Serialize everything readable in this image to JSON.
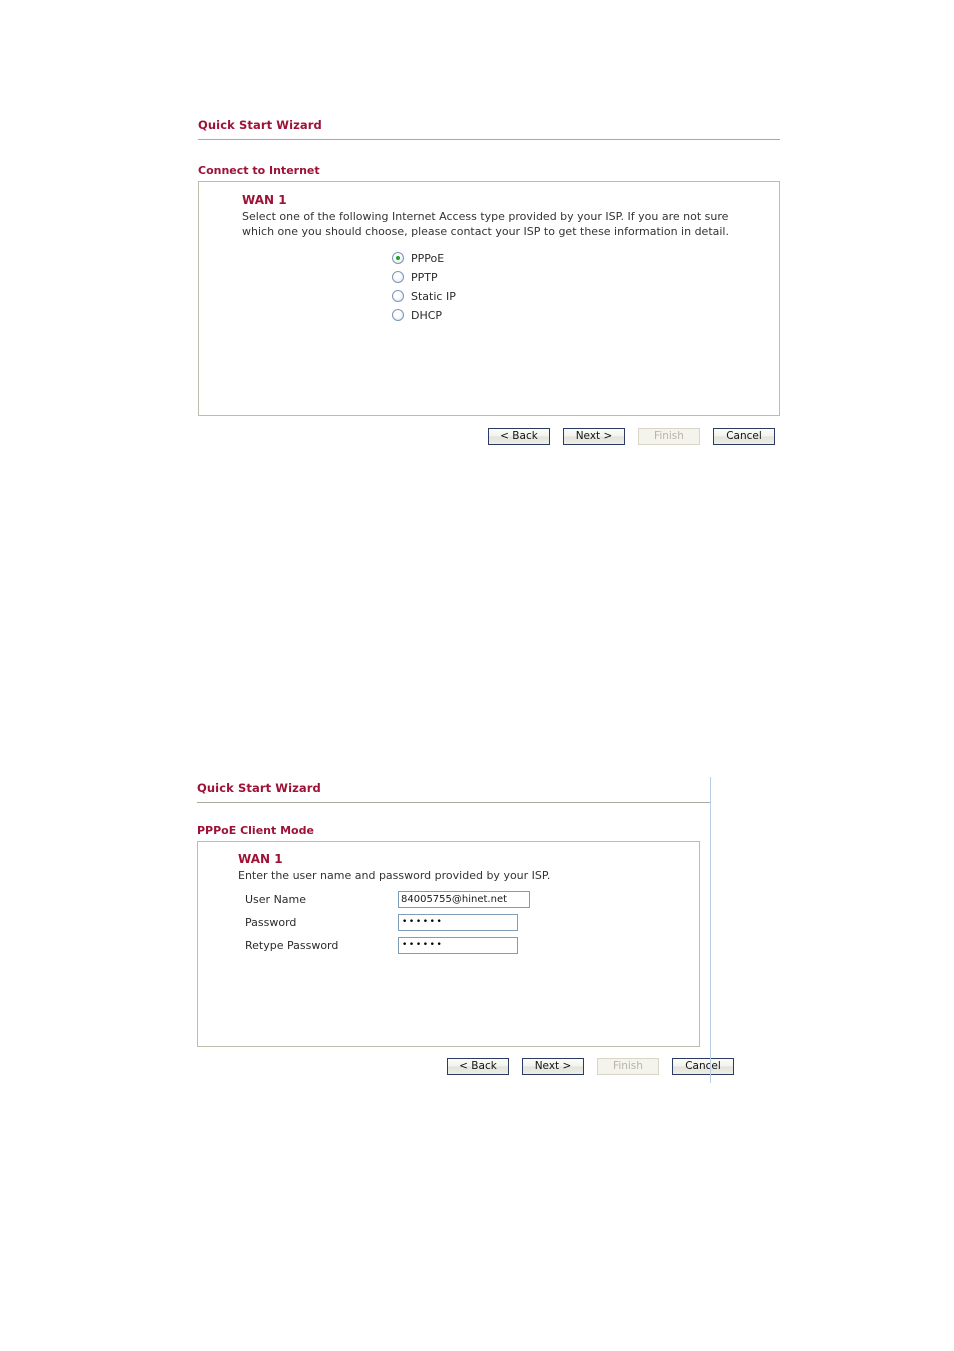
{
  "colors": {
    "heading": "#9d1236",
    "panel_border": "#bdbdaa",
    "rule": "#a9a9a0",
    "radio_selected_dot": "#22a02a",
    "input_border": "#7f9db9",
    "button_border": "#2a3c63",
    "divider": "#b9cee2"
  },
  "section_one": {
    "title": "Quick Start Wizard",
    "subtitle": "Connect to Internet",
    "wan_label": "WAN 1",
    "description": "Select one of the following Internet Access type provided by your ISP. If you are not sure which one you should choose, please contact your ISP to get these information in detail.",
    "access_types": [
      {
        "label": "PPPoE",
        "selected": true
      },
      {
        "label": "PPTP",
        "selected": false
      },
      {
        "label": "Static IP",
        "selected": false
      },
      {
        "label": "DHCP",
        "selected": false
      }
    ],
    "buttons": [
      {
        "label": "< Back",
        "disabled": false
      },
      {
        "label": "Next >",
        "disabled": false
      },
      {
        "label": "Finish",
        "disabled": true
      },
      {
        "label": "Cancel",
        "disabled": false
      }
    ]
  },
  "section_two": {
    "title": "Quick Start Wizard",
    "subtitle": "PPPoE Client Mode",
    "wan_label": "WAN 1",
    "description": "Enter the user name and password provided by your ISP.",
    "fields": [
      {
        "label": "User Name",
        "value": "84005755@hinet.net",
        "type": "text"
      },
      {
        "label": "Password",
        "value": "••••••",
        "type": "password"
      },
      {
        "label": "Retype Password",
        "value": "••••••",
        "type": "password"
      }
    ],
    "buttons": [
      {
        "label": "< Back",
        "disabled": false
      },
      {
        "label": "Next >",
        "disabled": false
      },
      {
        "label": "Finish",
        "disabled": true
      },
      {
        "label": "Cancel",
        "disabled": false
      }
    ]
  }
}
